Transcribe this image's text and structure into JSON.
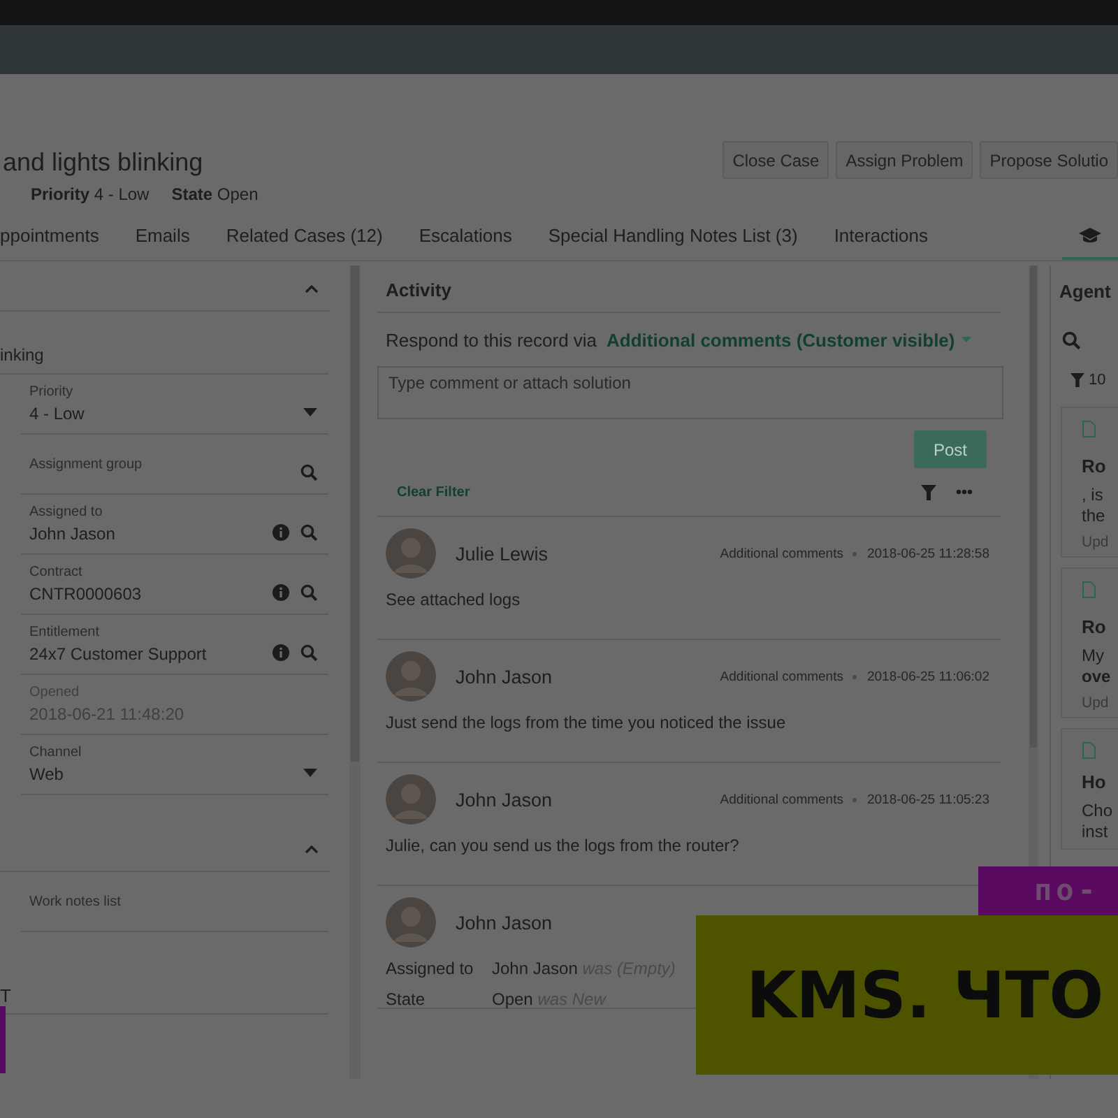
{
  "header": {
    "title": "and lights blinking",
    "meta": [
      "**Priority** 4 - Low",
      "**State** Open"
    ],
    "buttons": [
      "Close Case",
      "Assign Problem",
      "Propose Solutio"
    ]
  },
  "tabs": [
    {
      "kind": "text",
      "label": "ppointments",
      "selected": false
    },
    {
      "kind": "text",
      "label": "Emails",
      "selected": false
    },
    {
      "kind": "text",
      "label": "Related Cases (12)",
      "selected": false
    },
    {
      "kind": "text",
      "label": "Escalations",
      "selected": false
    },
    {
      "kind": "text",
      "label": "Special Handling Notes List (3)",
      "selected": false
    },
    {
      "kind": "text",
      "label": "Interactions",
      "selected": false
    },
    {
      "kind": "icon",
      "selected": true
    }
  ],
  "left_panel": {
    "sections": [
      {
        "expanded": true,
        "fields": [
          {
            "value": "inking",
            "dropdown": false,
            "info": false,
            "lookup": false,
            "disabled": false
          },
          {
            "label": "Priority",
            "value": "4 - Low",
            "dropdown": true,
            "info": false,
            "lookup": false,
            "disabled": false
          },
          {
            "label": "Assignment group",
            "dropdown": false,
            "info": false,
            "lookup": true,
            "disabled": false
          },
          {
            "label": "Assigned to",
            "value": "John Jason",
            "dropdown": false,
            "info": true,
            "lookup": true,
            "disabled": false
          },
          {
            "label": "Contract",
            "value": "CNTR0000603",
            "dropdown": false,
            "info": true,
            "lookup": true,
            "disabled": false
          },
          {
            "label": "Entitlement",
            "value": "24x7 Customer Support",
            "dropdown": false,
            "info": true,
            "lookup": true,
            "disabled": false
          },
          {
            "label": "Opened",
            "value": "2018-06-21 11:48:20",
            "dropdown": false,
            "info": false,
            "lookup": false,
            "disabled": true
          },
          {
            "label": "Channel",
            "value": "Web",
            "dropdown": true,
            "info": false,
            "lookup": false,
            "disabled": false
          }
        ]
      },
      {
        "expanded": true,
        "fields": [
          {
            "label": "Work notes list",
            "dropdown": false,
            "info": false,
            "lookup": false,
            "disabled": false
          }
        ]
      }
    ],
    "next_section_title": "T"
  },
  "activity": {
    "title": "Activity",
    "respond_label": "Respond to this record via",
    "channel": "Additional comments (Customer visible)",
    "placeholder": "Type comment or attach solution",
    "post_button": {
      "label": "Post",
      "disabled": true
    },
    "clear_filter": "Clear Filter",
    "entries": [
      {
        "kind": "comment",
        "author": "Julie Lewis",
        "type": "Additional comments",
        "time": "2018-06-25 11:28:58",
        "text": "See attached logs"
      },
      {
        "kind": "comment",
        "author": "John Jason",
        "type": "Additional comments",
        "time": "2018-06-25 11:06:02",
        "text": "Just send the logs from the time you noticed the issue"
      },
      {
        "kind": "comment",
        "author": "John Jason",
        "type": "Additional comments",
        "time": "2018-06-25 11:05:23",
        "text": "Julie, can you send us the logs from the router?"
      },
      {
        "kind": "changes",
        "author": "John Jason",
        "changes": [
          {
            "field": "Assigned to",
            "value": "John Jason",
            "was": "was (Empty)"
          },
          {
            "field": "State",
            "value": "Open",
            "was": "was New"
          }
        ]
      }
    ]
  },
  "agent_panel": {
    "title": "Agent",
    "filter_count": "10",
    "cards": [
      {
        "title": "Ro",
        "lines": [
          {
            "text": ", is",
            "bold": false
          },
          {
            "text": "the",
            "bold": false
          }
        ],
        "footer": "Upd"
      },
      {
        "title": "Ro",
        "lines": [
          {
            "text": "My",
            "bold": false
          },
          {
            "text": "ove",
            "bold": true
          }
        ],
        "footer": "Upd"
      },
      {
        "title": "Ho",
        "lines": [
          {
            "text": "Cho",
            "bold": false
          },
          {
            "text": "inst",
            "bold": false
          }
        ]
      }
    ]
  },
  "captions": {
    "small": "по-",
    "large": "KMS. ЧТО"
  }
}
